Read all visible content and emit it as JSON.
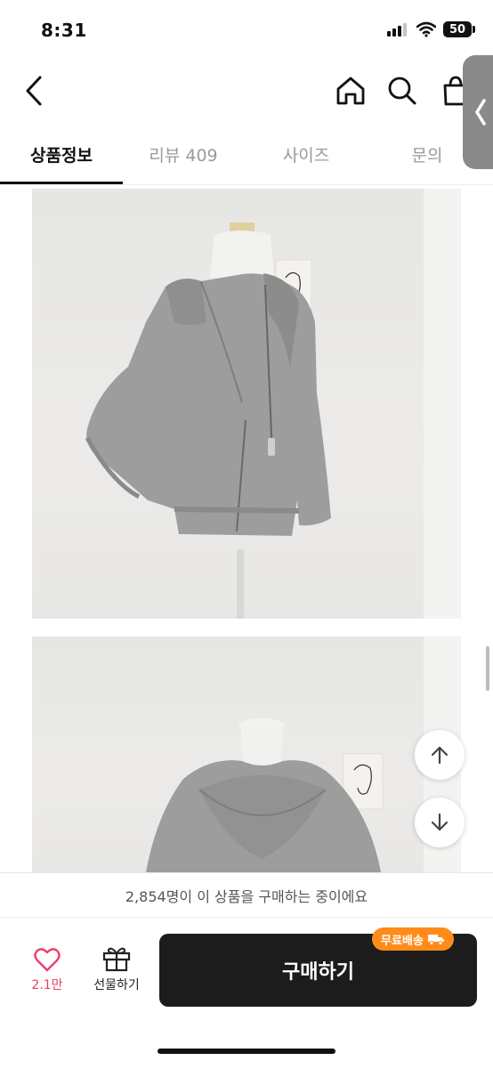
{
  "status_bar": {
    "time": "8:31",
    "battery": "50",
    "signal_icon": "cellular-signal-icon",
    "wifi_icon": "wifi-icon"
  },
  "nav": {
    "back_icon": "chevron-left-icon",
    "home_icon": "home-icon",
    "search_icon": "search-icon",
    "bag_icon": "shopping-bag-icon",
    "side_handle_icon": "chevron-left-icon"
  },
  "tabs": [
    {
      "label": "상품정보",
      "active": true
    },
    {
      "label": "리뷰 409",
      "active": false
    },
    {
      "label": "사이즈",
      "active": false
    },
    {
      "label": "문의",
      "active": false
    }
  ],
  "images": [
    {
      "name": "product-photo-1",
      "subject": "gray cropped zip-up hoodie on mannequin"
    },
    {
      "name": "product-photo-2",
      "subject": "gray cropped zip-up hoodie back view"
    }
  ],
  "floating": {
    "up_icon": "arrow-up-icon",
    "down_icon": "arrow-down-icon"
  },
  "bottom": {
    "purchasing_text": "2,854명이 이 상품을 구매하는 중이에요",
    "like_count": "2.1만",
    "like_icon": "heart-icon",
    "gift_label": "선물하기",
    "gift_icon": "gift-icon",
    "buy_label": "구매하기",
    "free_shipping_badge": "무료배송",
    "truck_icon": "truck-icon"
  },
  "colors": {
    "accent_pink": "#ef3d6b",
    "badge_orange": "#ff8c1a",
    "buy_button": "#1c1c1c"
  }
}
